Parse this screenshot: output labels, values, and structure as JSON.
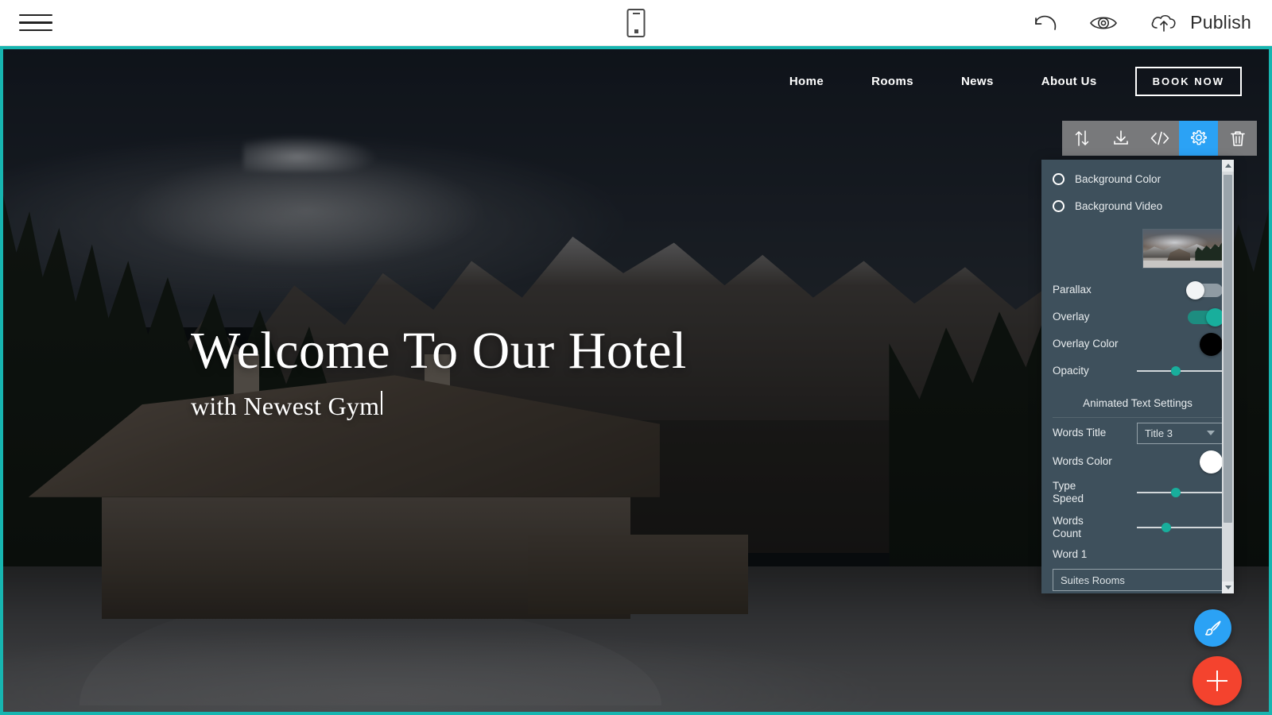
{
  "app_bar": {
    "menu_icon": "hamburger-menu-icon",
    "device_preview_icon": "mobile-device-icon",
    "undo_icon": "undo-arrow-icon",
    "preview_icon": "eye-preview-icon",
    "publish_icon": "cloud-upload-icon",
    "publish_label": "Publish"
  },
  "site": {
    "nav_links": [
      {
        "label": "Home"
      },
      {
        "label": "Rooms"
      },
      {
        "label": "News"
      },
      {
        "label": "About Us"
      }
    ],
    "cta_label": "BOOK NOW",
    "hero_title": "Welcome To Our Hotel",
    "hero_subtitle": "with Newest Gym"
  },
  "block_toolbar": {
    "buttons": [
      {
        "name": "move-block-icon",
        "glyph": "move-updown"
      },
      {
        "name": "download-block-icon",
        "glyph": "download"
      },
      {
        "name": "edit-code-icon",
        "glyph": "code"
      },
      {
        "name": "block-settings-icon",
        "glyph": "gear",
        "active": true
      },
      {
        "name": "delete-block-icon",
        "glyph": "trash"
      }
    ],
    "active_color": "#2ba2f5"
  },
  "settings_panel": {
    "background_color_option": "Background Color",
    "background_video_option": "Background Video",
    "thumbnail_name": "background-image-thumbnail",
    "parallax_label": "Parallax",
    "parallax_state": "off",
    "overlay_label": "Overlay",
    "overlay_state": "on",
    "overlay_color_label": "Overlay Color",
    "overlay_color_value": "#000000",
    "opacity_label": "Opacity",
    "opacity_percent": 45,
    "animated_text_header": "Animated Text Settings",
    "words_title_label": "Words Title",
    "words_title_value": "Title 3",
    "words_color_label": "Words Color",
    "words_color_value": "#ffffff",
    "type_speed_label": "Type\nSpeed",
    "type_speed_line1": "Type",
    "type_speed_line2": "Speed",
    "type_speed_percent": 45,
    "words_count_label_line1": "Words",
    "words_count_label_line2": "Count",
    "words_count_percent": 30,
    "word1_label": "Word 1",
    "word1_value": "Suites Rooms",
    "accent_color": "#18ae9c"
  },
  "fabs": {
    "style_icon": "paintbrush-icon",
    "add_icon": "plus-icon",
    "style_color": "#2ba2f5",
    "add_color": "#f4432e"
  },
  "canvas": {
    "selection_border_color": "#17b5b0"
  }
}
